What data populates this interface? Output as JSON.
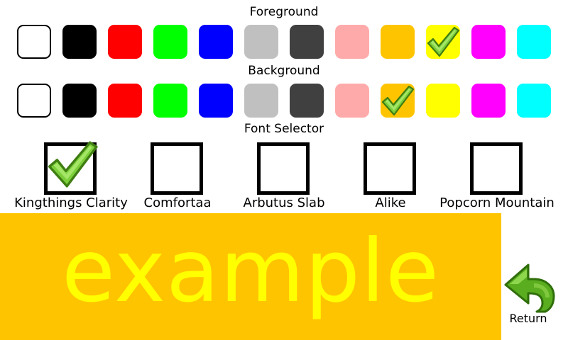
{
  "foreground": {
    "label": "Foreground",
    "selected_index": 9,
    "colors": [
      {
        "name": "white",
        "hex": "#ffffff"
      },
      {
        "name": "black",
        "hex": "#000000"
      },
      {
        "name": "red",
        "hex": "#ff0000"
      },
      {
        "name": "green",
        "hex": "#00ff00"
      },
      {
        "name": "blue",
        "hex": "#0000ff"
      },
      {
        "name": "light-gray",
        "hex": "#c0c0c0"
      },
      {
        "name": "dark-gray",
        "hex": "#404040"
      },
      {
        "name": "pink",
        "hex": "#ffaaaa"
      },
      {
        "name": "orange",
        "hex": "#ffc400"
      },
      {
        "name": "yellow",
        "hex": "#ffff00"
      },
      {
        "name": "magenta",
        "hex": "#ff00ff"
      },
      {
        "name": "cyan",
        "hex": "#00ffff"
      }
    ]
  },
  "background": {
    "label": "Background",
    "selected_index": 8,
    "colors": [
      {
        "name": "white",
        "hex": "#ffffff"
      },
      {
        "name": "black",
        "hex": "#000000"
      },
      {
        "name": "red",
        "hex": "#ff0000"
      },
      {
        "name": "green",
        "hex": "#00ff00"
      },
      {
        "name": "blue",
        "hex": "#0000ff"
      },
      {
        "name": "light-gray",
        "hex": "#c0c0c0"
      },
      {
        "name": "dark-gray",
        "hex": "#404040"
      },
      {
        "name": "pink",
        "hex": "#ffaaaa"
      },
      {
        "name": "orange",
        "hex": "#ffc400"
      },
      {
        "name": "yellow",
        "hex": "#ffff00"
      },
      {
        "name": "magenta",
        "hex": "#ff00ff"
      },
      {
        "name": "cyan",
        "hex": "#00ffff"
      }
    ]
  },
  "font_selector": {
    "label": "Font Selector",
    "selected_index": 0,
    "fonts": [
      {
        "label": "Kingthings Clarity"
      },
      {
        "label": "Comfortaa"
      },
      {
        "label": "Arbutus Slab"
      },
      {
        "label": "Alike"
      },
      {
        "label": "Popcorn Mountain"
      }
    ]
  },
  "preview": {
    "text": "example",
    "foreground_hex": "#ffff00",
    "background_hex": "#ffc400"
  },
  "return_button": {
    "label": "Return",
    "icon": "return-arrow-icon"
  },
  "check_icon": "checkmark-icon"
}
